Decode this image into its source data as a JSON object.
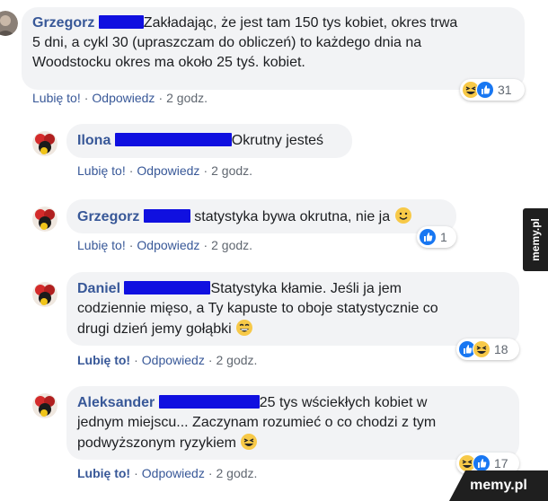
{
  "comments": [
    {
      "author": "Grzegorz",
      "line1": "Zakładając, że jest tam 150 tys kobiet, okres trwa",
      "line2": "5 dni, a cykl 30 (upraszczam do obliczeń) to każdego dnia na",
      "line3": "Woodstocku okres ma około 25 tyś. kobiet.",
      "like": "Lubię to!",
      "reply": "Odpowiedz",
      "time": "2 godz.",
      "reaction_count": "31",
      "reaction_icons": [
        "laugh-emoji",
        "like-icon"
      ]
    },
    {
      "author": "Ilona",
      "line1": "Okrutny jesteś",
      "like": "Lubię to!",
      "reply": "Odpowiedz",
      "time": "2 godz."
    },
    {
      "author": "Grzegorz",
      "line1": "statystyka bywa okrutna, nie ja",
      "like": "Lubię to!",
      "reply": "Odpowiedz",
      "time": "2 godz.",
      "reaction_count": "1",
      "reaction_icons": [
        "like-icon"
      ]
    },
    {
      "author": "Daniel",
      "line1": "Statystyka kłamie. Jeśli ja jem",
      "line2": "codziennie mięso, a Ty kapuste to oboje statystycznie co",
      "line3": "drugi dzień jemy gołąbki",
      "like": "Lubię to!",
      "reply": "Odpowiedz",
      "time": "2 godz.",
      "reaction_count": "18",
      "reaction_icons": [
        "like-icon",
        "laugh-emoji"
      ]
    },
    {
      "author": "Aleksander",
      "line1": "25 tys wściekłych kobiet w",
      "line2": "jednym miejscu... Zaczynam rozumieć o co chodzi z tym",
      "line3": "podwyższonym ryzykiem",
      "like": "Lubię to!",
      "reply": "Odpowiedz",
      "time": "2 godz.",
      "reaction_count": "17",
      "reaction_icons": [
        "laugh-emoji",
        "like-icon"
      ]
    }
  ],
  "watermark": {
    "side": "memy.pl",
    "corner": "memy.pl"
  },
  "colors": {
    "author": "#385898",
    "bubble": "#f2f3f5",
    "redaction": "#1010e0",
    "like_blue": "#1877f2",
    "emoji_yellow": "#f7c948"
  }
}
